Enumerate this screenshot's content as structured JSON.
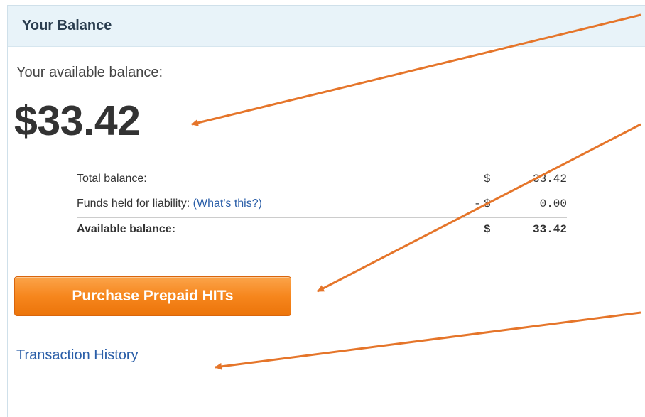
{
  "panel": {
    "title": "Your Balance"
  },
  "balance": {
    "available_label": "Your available balance:",
    "available_amount": "$33.42"
  },
  "breakdown": {
    "rows": [
      {
        "label": "Total balance:",
        "sign": "",
        "currency": "$",
        "amount": "33.42"
      },
      {
        "label": "Funds held for liability:",
        "link": "(What's this?)",
        "sign": "-",
        "currency": "$",
        "amount": "0.00"
      },
      {
        "label": "Available balance:",
        "sign": "",
        "currency": "$",
        "amount": "33.42"
      }
    ]
  },
  "actions": {
    "purchase_label": "Purchase Prepaid HITs",
    "history_label": "Transaction History"
  },
  "colors": {
    "header_bg": "#e8f3f9",
    "link": "#2a5ea8",
    "button_orange": "#f6861d",
    "arrow": "#e5752a"
  },
  "annotations": {
    "arrow_count": 3
  }
}
